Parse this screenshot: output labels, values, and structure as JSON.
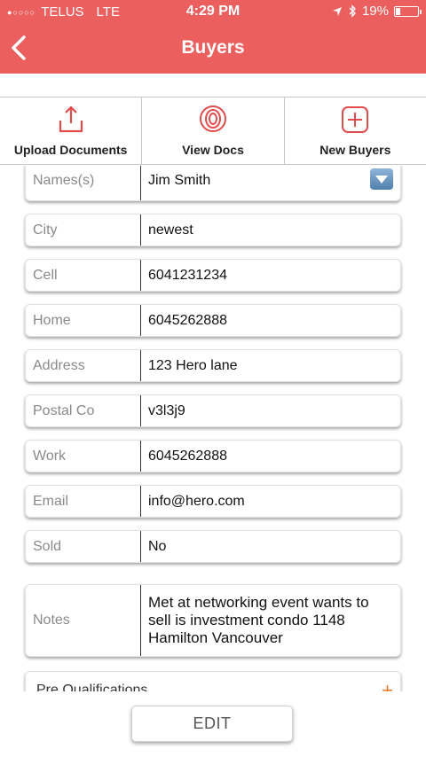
{
  "status_bar": {
    "carrier": "TELUS",
    "network": "LTE",
    "time": "4:29 PM",
    "battery": "19%",
    "battery_level": 0.19
  },
  "nav": {
    "title": "Buyers",
    "back_icon": "chevron-left-icon"
  },
  "toolbar": {
    "items": [
      {
        "label": "Upload Documents",
        "icon": "upload-icon"
      },
      {
        "label": "View Docs",
        "icon": "eye-icon"
      },
      {
        "label": "New Buyers",
        "icon": "plus-box-icon"
      }
    ]
  },
  "form": {
    "fields": [
      {
        "label": "Names(s)",
        "value": "Jim Smith"
      },
      {
        "label": "City",
        "value": "newest"
      },
      {
        "label": "Cell",
        "value": "6041231234"
      },
      {
        "label": "Home",
        "value": "6045262888"
      },
      {
        "label": "Address",
        "value": "123 Hero lane"
      },
      {
        "label": "Postal Co",
        "value": "v3l3j9"
      },
      {
        "label": "Work",
        "value": "6045262888"
      },
      {
        "label": "Email",
        "value": "info@hero.com"
      },
      {
        "label": "Sold",
        "value": "No"
      },
      {
        "label": "Notes",
        "value": "Met at networking event wants to sell is investment condo 1148 Hamilton Vancouver"
      }
    ],
    "pre_qualifications": {
      "label": "Pre Qualifications",
      "icon": "plus-icon"
    }
  },
  "actions": {
    "edit_label": "EDIT"
  },
  "colors": {
    "accent": "#eb5f5f",
    "dropdown": "#5f8cba",
    "plus": "#e07a2d"
  }
}
